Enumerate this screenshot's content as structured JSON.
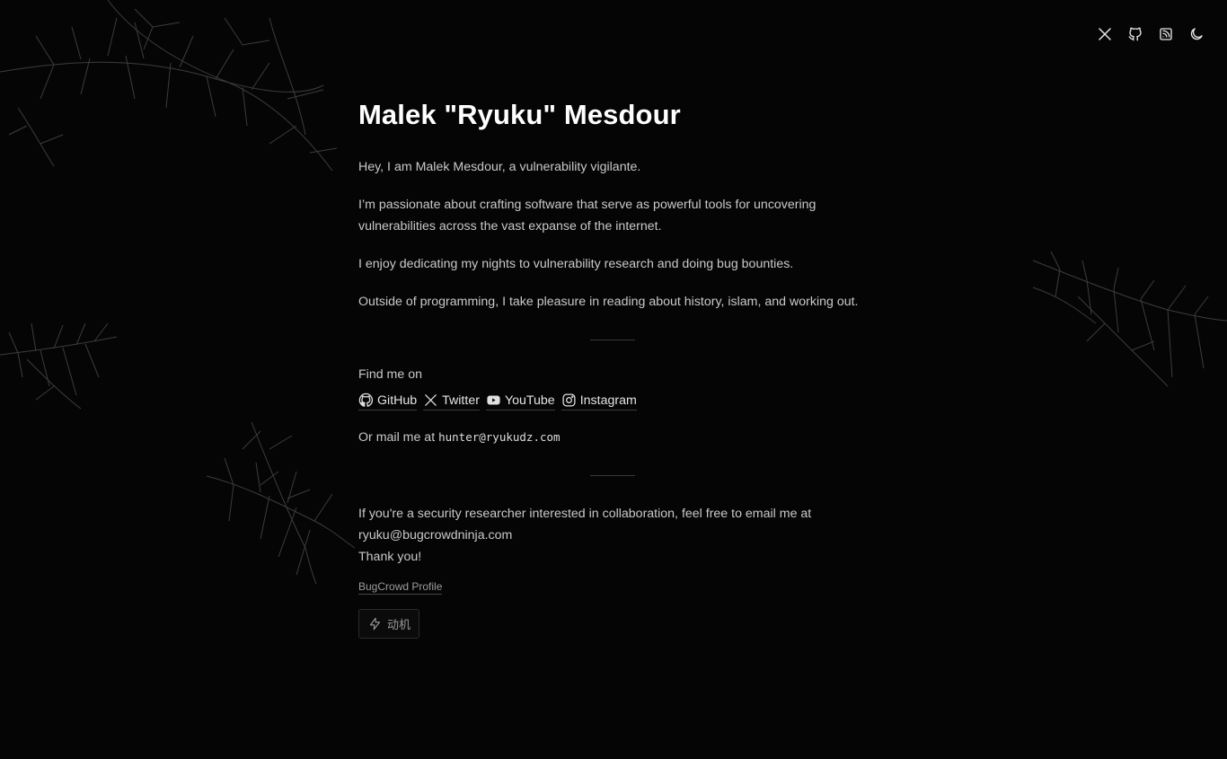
{
  "nav": {
    "icons": [
      "x-twitter-icon",
      "github-icon",
      "rss-icon",
      "moon-icon"
    ]
  },
  "header": {
    "title": "Malek \"Ryuku\" Mesdour"
  },
  "intro": {
    "p1": "Hey, I am Malek Mesdour, a vulnerability vigilante.",
    "p2": "I’m passionate about crafting software that serve as powerful tools for uncovering vulnerabilities across the vast expanse of the internet.",
    "p3": "I enjoy dedicating my nights to vulnerability research and doing bug bounties.",
    "p4": "Outside of programming, I take pleasure in reading about history, islam, and working out."
  },
  "contact": {
    "find_label": "Find me on",
    "links": [
      {
        "label": "GitHub",
        "icon": "github-icon"
      },
      {
        "label": "Twitter",
        "icon": "x-twitter-icon"
      },
      {
        "label": "YouTube",
        "icon": "youtube-icon"
      },
      {
        "label": "Instagram",
        "icon": "instagram-icon"
      }
    ],
    "mail_prefix": "Or mail me at ",
    "mail_address": "hunter@ryukudz.com"
  },
  "collab": {
    "line1": "If you're a security researcher interested in collaboration, feel free to email me at",
    "line2": "ryuku@bugcrowdninja.com",
    "line3": "Thank you!"
  },
  "footer": {
    "profile_link": "BugCrowd Profile",
    "motive_label": "动机",
    "motive_icon": "lightning-icon"
  },
  "colors": {
    "background": "#050505",
    "title": "#ffffff",
    "text": "#c9c9c9",
    "muted": "#9c9c9c"
  }
}
